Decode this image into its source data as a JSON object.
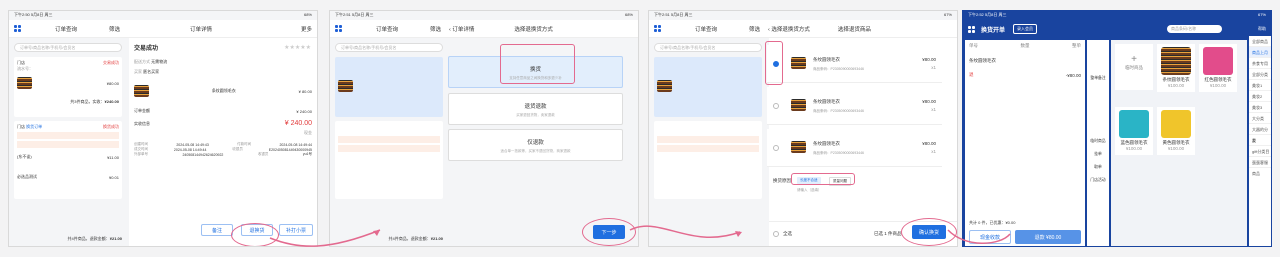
{
  "s1": {
    "status_time": "下午2:50 5月8日 周三",
    "status_battery": "68%",
    "left_title": "订单查询",
    "filter_label": "筛选",
    "right_title": "订单详情",
    "more_label": "更多",
    "search_placeholder": "订单号/商品名称/手机号/会员名",
    "store_label": "门店",
    "order_type": "普通订单",
    "status_done": "交易成功",
    "order_no_prefix": "流水号：",
    "time_prefix": "下单时间",
    "product_name": "条纹圆领毛衣",
    "price_80": "¥80.00",
    "qty_1": "x1",
    "total_line": "共3件商品，实收：",
    "total_240": "¥240.00",
    "exchange_done": "换货成功",
    "badge_exchange": "换货订单",
    "detail_heading": "交易成功",
    "delivery_label": "配送方式",
    "delivery_value": "无需物流",
    "buyer_label": "买家",
    "buyer_value": "匿名买家",
    "sub_prod": "条纹圆领毛衣",
    "sub_price": "¥ 80.00",
    "amount_label": "订单金额",
    "amount_value": "¥ 240.00",
    "paid_label": "实收信息",
    "paid_value": "¥ 240.00",
    "paid_note": "现金",
    "price_11": "¥11.00",
    "price_001": "¥0.01",
    "zhang_label": "(东不谈)",
    "test_label": "必选品测试",
    "footer_total": "共4件商品，退款金额：",
    "footer_amount": "¥21.00",
    "info_rows": [
      [
        "创建时间",
        "2024-05-08 14:49:43",
        "付款时间",
        "2024-05-08 14:49:44"
      ],
      [
        "成交时间",
        "2024-05-08 14:49:44",
        "收银员",
        "E202405081449430000945"
      ],
      [
        "外部单号",
        "240508144942624620922",
        "收银员",
        "yu1号"
      ]
    ],
    "btn_remark": "备注",
    "btn_return": "退换货",
    "btn_reprint": "补打小票"
  },
  "s2": {
    "status_time": "下午2:51 5月8日 周三",
    "status_battery": "68%",
    "left_title": "订单查询",
    "filter_label": "筛选",
    "back_label": "订单详情",
    "page_title": "选择退换货方式",
    "search_placeholder": "订单号/商品名称/手机号/会员名",
    "opt1_title": "换货",
    "opt1_desc": "支持任意商品之间换货和多退少补",
    "opt2_title": "退货退款",
    "opt2_desc": "买家退回货物，卖家退款",
    "opt3_title": "仅退款",
    "opt3_desc": "适合单一抵款等，买家不退回货物，商家退款",
    "next_btn": "下一步",
    "footer_total": "共4件商品，退款金额：",
    "footer_amount": "¥21.00"
  },
  "s3": {
    "status_time": "下午2:51 5月8日 周三",
    "status_battery": "67%",
    "left_title": "订单查询",
    "filter_label": "筛选",
    "back_label": "选择退换货方式",
    "page_title": "选择退货商品",
    "product_name": "条纹圆领毛衣",
    "product_code": "商品条码：P2305090000693446",
    "price": "¥80.00",
    "qty": "x1",
    "exchange_reason_label": "换货原因",
    "reason_chip_1": "长度不合适",
    "reason_chip_2": "质量问题",
    "remark_placeholder": "请输入（选填）",
    "select_all": "全选",
    "selected_count": "已选 1 件商品",
    "confirm_btn": "确认换货",
    "footer_total": "共4件商品，退款金额：",
    "footer_amount": "¥21.00"
  },
  "s4": {
    "status_time": "下午2:52 5月8日 周三",
    "status_battery": "67%",
    "title": "换货开单",
    "member_btn": "录入会员",
    "search_placeholder": "商品条码/名称",
    "help_label": "帮助",
    "sel_price_label": "整单",
    "col_size": "单号",
    "col_qty": "数量",
    "col_amount": "金额",
    "cart_item": "条纹圆领毛衣",
    "cart_price": "-¥80.00",
    "cart_tag": "退",
    "side_actions": [
      "临时商品",
      "挂单",
      "取单",
      "门店活动",
      "整单备注"
    ],
    "summary": "共计 0 件，已优惠：¥0.00",
    "btn_cash": "现金收款",
    "btn_refund": "退款 ¥80.00",
    "temp_product": "临时商品",
    "categories": [
      "全部商品",
      "商品上月",
      "茶食专用",
      "全部分类",
      "美妆1",
      "美妆2",
      "美妆3",
      "大分类",
      "大器的分类",
      "发",
      "gift分类目",
      "蛋蛋客服商品"
    ],
    "products": [
      {
        "name": "条纹圆领毛衣",
        "price": "¥100.00"
      },
      {
        "name": "红色圆领毛衣",
        "price": "¥100.00"
      },
      {
        "name": "蓝色圆领毛衣",
        "price": "¥100.00"
      },
      {
        "name": "黄色圆领毛衣",
        "price": "¥100.00"
      }
    ]
  },
  "colors": {
    "accent": "#1f6fe0",
    "highlight": "#e36a8f",
    "danger": "#e23b3b",
    "pos_header": "#19449f"
  }
}
